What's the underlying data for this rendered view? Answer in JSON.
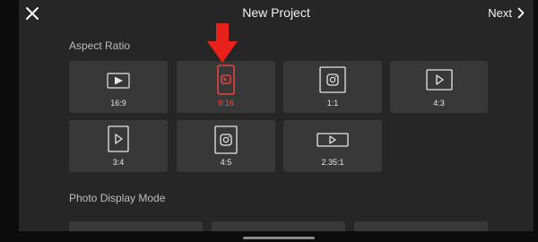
{
  "header": {
    "title": "New Project",
    "next_label": "Next"
  },
  "sections": {
    "aspect_ratio": "Aspect Ratio",
    "photo_display_mode": "Photo Display Mode"
  },
  "aspect_ratios": [
    {
      "label": "16:9",
      "icon": "youtube-icon",
      "selected": false
    },
    {
      "label": "9:16",
      "icon": "tiktok-icon",
      "selected": true
    },
    {
      "label": "1:1",
      "icon": "instagram-icon",
      "selected": false
    },
    {
      "label": "4:3",
      "icon": "play-icon",
      "selected": false
    },
    {
      "label": "3:4",
      "icon": "play-icon",
      "selected": false
    },
    {
      "label": "4:5",
      "icon": "instagram-icon",
      "selected": false
    },
    {
      "label": "2.35:1",
      "icon": "play-icon",
      "selected": false
    }
  ],
  "colors": {
    "background": "#262626",
    "tile": "#383838",
    "selected_accent": "#ff4a3d",
    "annotation_arrow": "#e8211b"
  }
}
